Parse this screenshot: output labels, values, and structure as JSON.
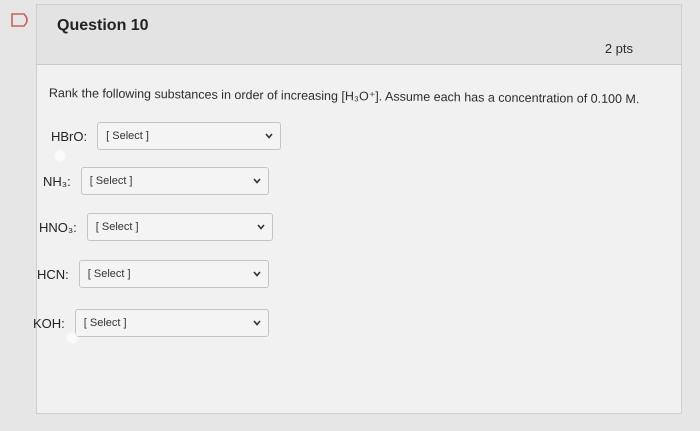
{
  "question": {
    "title": "Question 10",
    "points": "2 pts",
    "prompt": "Rank the following substances in order of increasing [H₃O⁺]. Assume each has a concentration of 0.100 M."
  },
  "items": [
    {
      "label": "HBrO:",
      "select_value": "[ Select ]"
    },
    {
      "label": "NH₃:",
      "select_value": "[ Select ]"
    },
    {
      "label": "HNO₃:",
      "select_value": "[ Select ]"
    },
    {
      "label": "HCN:",
      "select_value": "[ Select ]"
    },
    {
      "label": "KOH:",
      "select_value": "[ Select ]"
    }
  ],
  "icons": {
    "flag": "flag-icon",
    "dropdown": "chevron-down-icon"
  },
  "colors": {
    "background": "#e6e6e6",
    "card": "#f1f1f1",
    "header": "#e3e3e3"
  }
}
